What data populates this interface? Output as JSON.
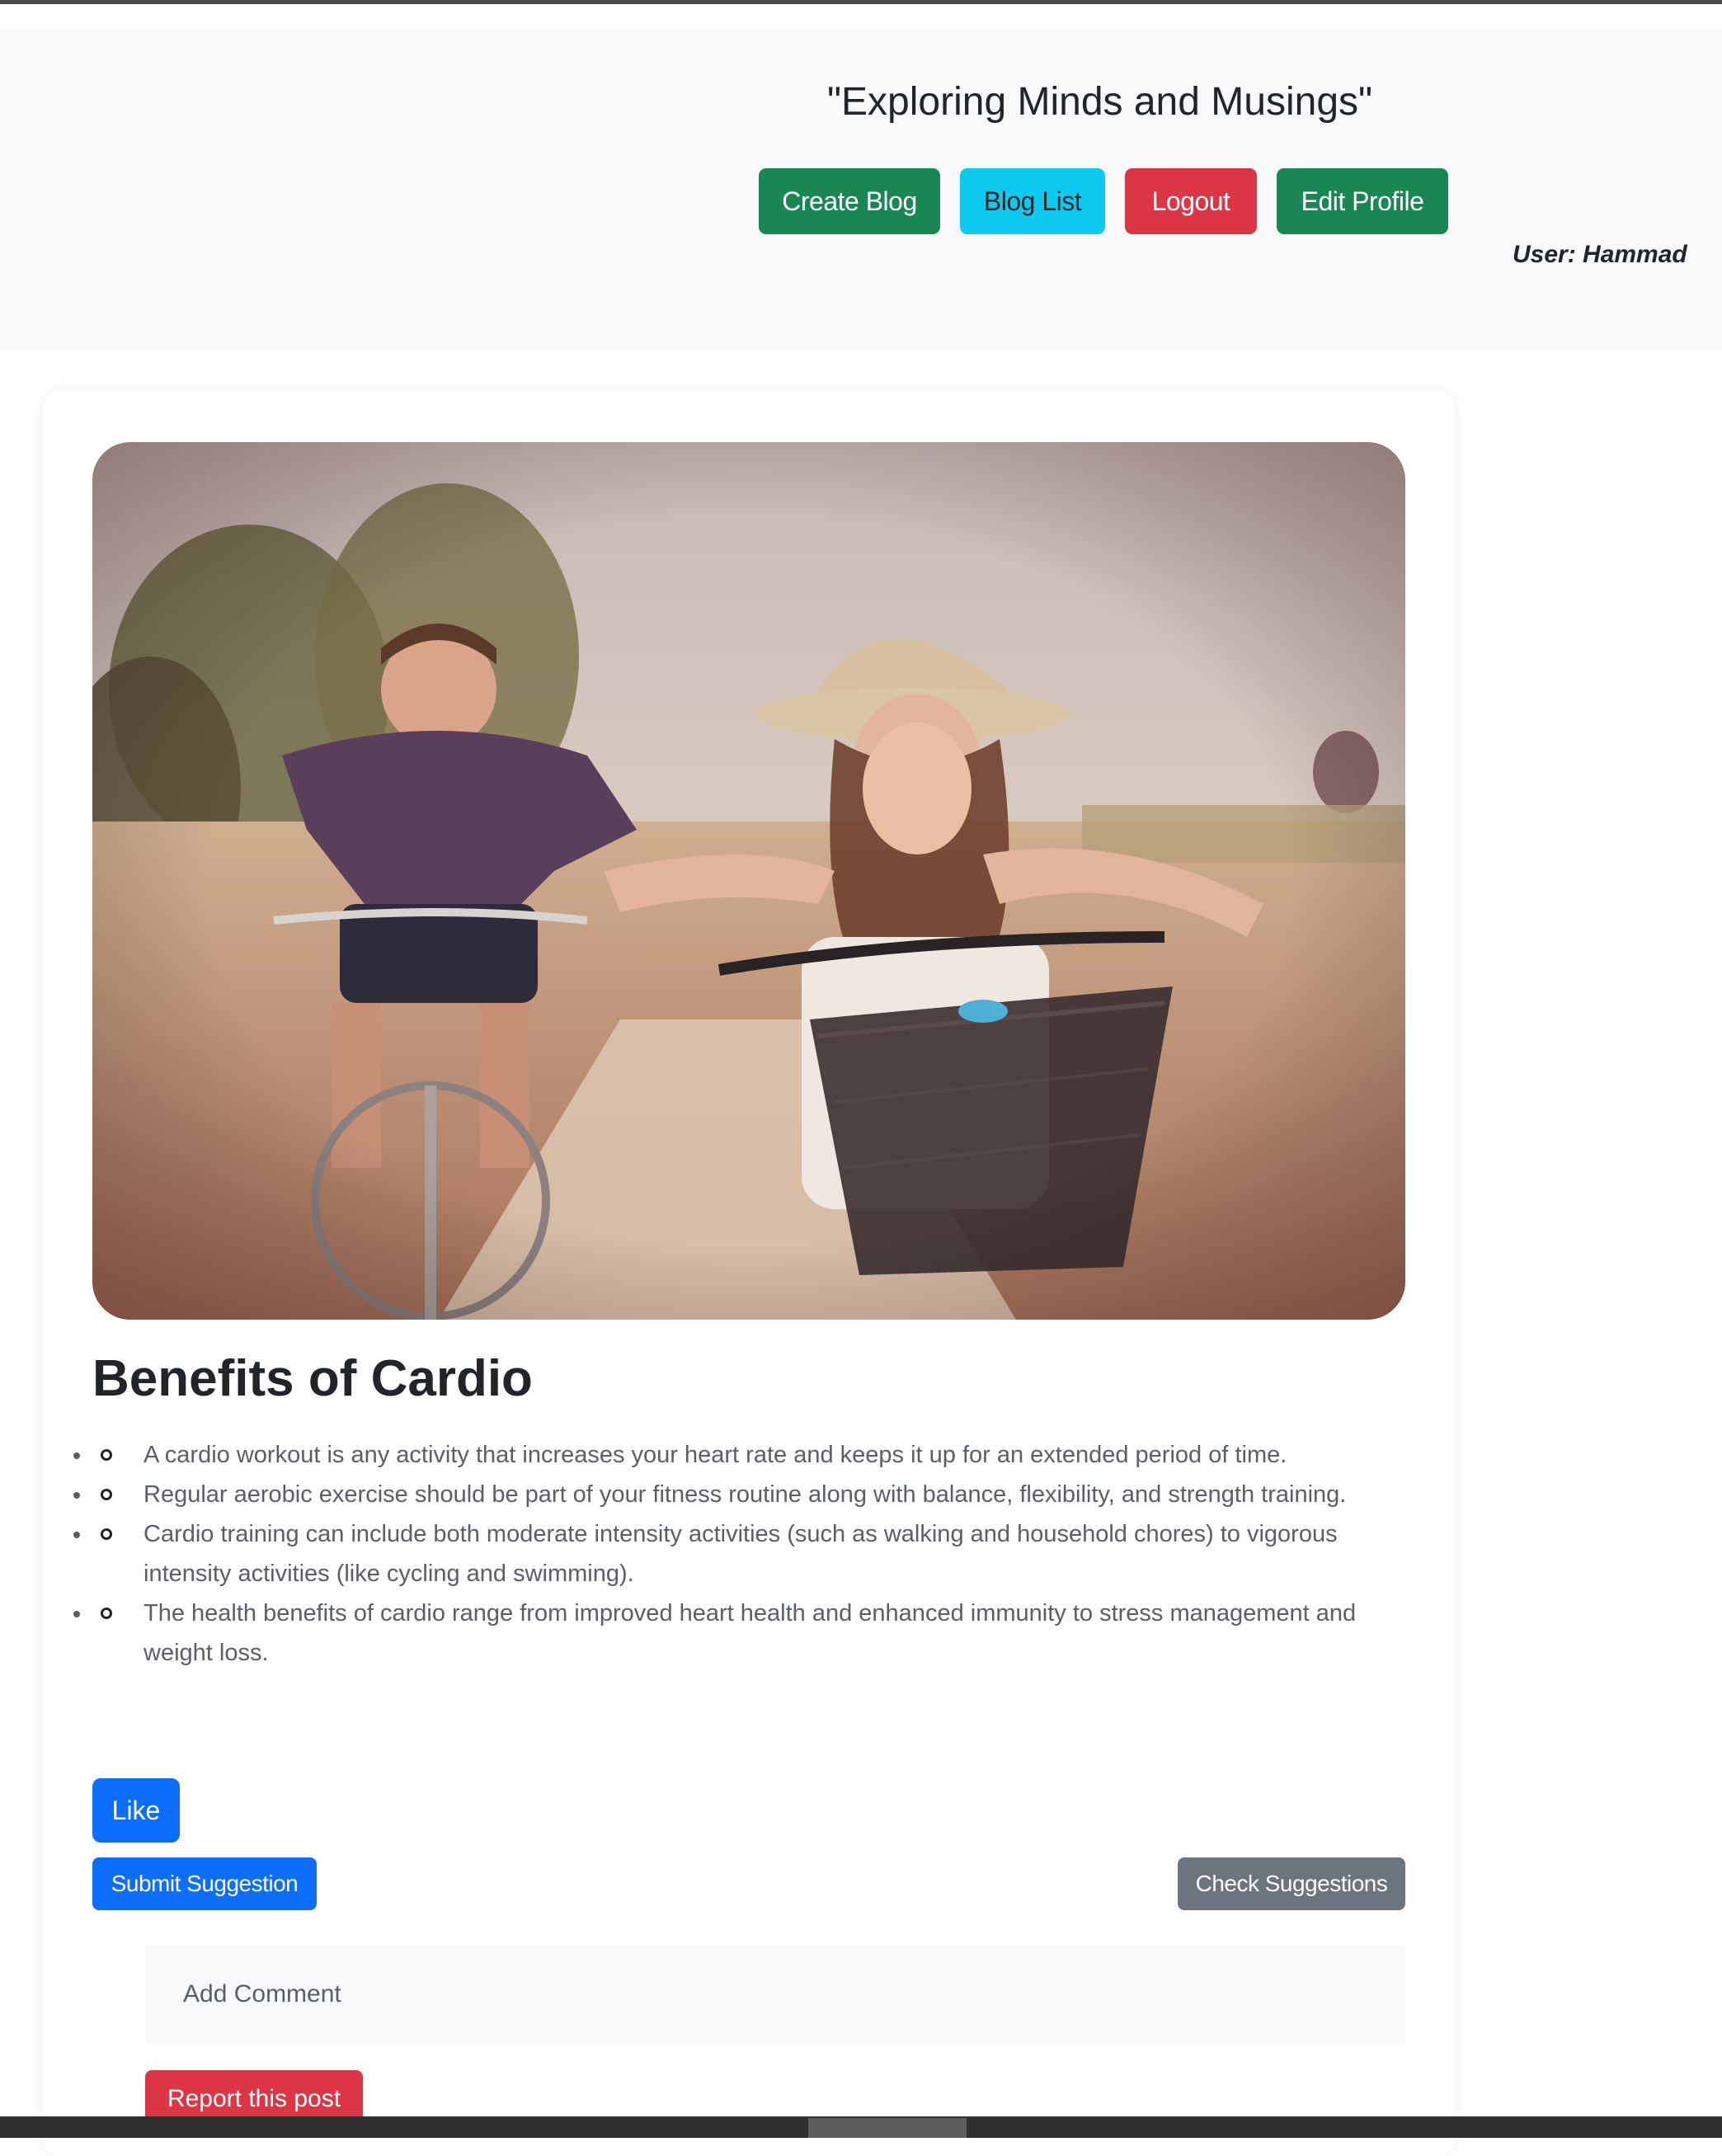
{
  "header": {
    "site_title": "\"Exploring Minds and Musings\"",
    "nav": {
      "create_blog": "Create Blog",
      "blog_list": "Blog List",
      "logout": "Logout",
      "edit_profile": "Edit Profile"
    },
    "user_label": "User: Hammad"
  },
  "post": {
    "image_icon": "photo-of-two-people-cycling",
    "title": "Benefits of Cardio",
    "bullets": [
      "A cardio workout is any activity that increases your heart rate and keeps it up for an extended period of time.",
      "Regular aerobic exercise should be part of your fitness routine along with balance, flexibility, and strength training.",
      "Cardio training can include both moderate intensity activities (such as walking and household chores) to vigorous intensity activities (like cycling and swimming).",
      "The health benefits of cardio range from improved heart health and enhanced immunity to stress management and weight loss."
    ],
    "like_label": "Like",
    "submit_suggestion_label": "Submit Suggestion",
    "check_suggestions_label": "Check Suggestions",
    "comment_placeholder": "Add Comment",
    "report_label": "Report this post"
  },
  "colors": {
    "success": "#198754",
    "info": "#0dcaf0",
    "danger": "#dc3545",
    "primary": "#0d6efd",
    "secondary": "#6c757d",
    "light": "#f8f9fa"
  }
}
